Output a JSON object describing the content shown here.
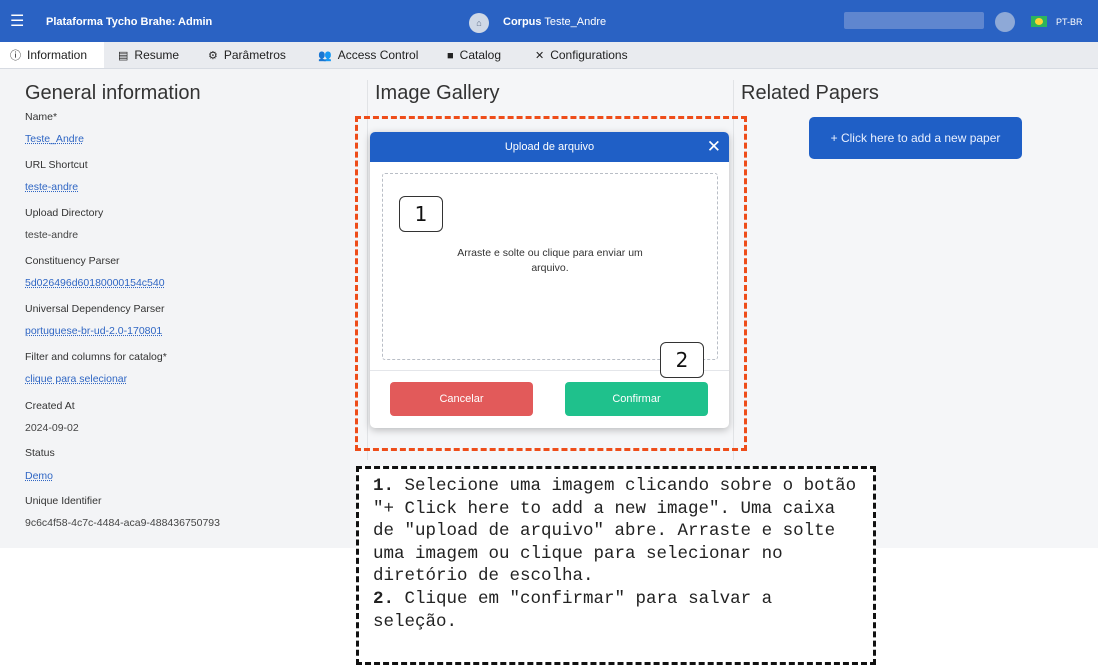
{
  "topbar": {
    "menu_icon": "hamburger-icon",
    "brand": "Plataforma Tycho Brahe: Admin",
    "corpus_label": "Corpus",
    "corpus_name": "Teste_Andre",
    "language": "PT-BR"
  },
  "tabs": [
    {
      "label": "Information",
      "icon": "info-icon"
    },
    {
      "label": "Resume",
      "icon": "document-icon"
    },
    {
      "label": "Parâmetros",
      "icon": "gears-icon"
    },
    {
      "label": "Access Control",
      "icon": "users-icon"
    },
    {
      "label": "Catalog",
      "icon": "book-icon"
    },
    {
      "label": "Configurations",
      "icon": "tools-icon"
    }
  ],
  "general": {
    "title": "General information",
    "fields": [
      {
        "label": "Name*",
        "value": "Teste_Andre"
      },
      {
        "label": "URL Shortcut",
        "value": "teste-andre"
      },
      {
        "label": "Upload Directory",
        "value": "teste-andre"
      },
      {
        "label": "Constituency Parser",
        "value": "5d026496d60180000154c540"
      },
      {
        "label": "Universal Dependency Parser",
        "value": "portuguese-br-ud-2.0-170801"
      },
      {
        "label": "Filter and columns for catalog*",
        "value": "clique para selecionar"
      },
      {
        "label": "Created At",
        "value": "2024-09-02"
      },
      {
        "label": "Status",
        "value": "Demo"
      },
      {
        "label": "Unique Identifier",
        "value": "9c6c4f58-4c7c-4484-aca9-488436750793"
      }
    ]
  },
  "gallery": {
    "title": "Image Gallery"
  },
  "papers": {
    "title": "Related Papers",
    "add_button": "+ Click here to add a new paper"
  },
  "modal": {
    "title": "Upload de arquivo",
    "drop_text": "Arraste e solte ou clique para enviar um arquivo.",
    "cancel": "Cancelar",
    "confirm": "Confirmar"
  },
  "markers": {
    "one": "1",
    "two": "2"
  },
  "instructions": {
    "n1": "1.",
    "t1": " Selecione uma imagem clicando sobre o botão \"+ Click here to add a new image\". Uma caixa de \"upload de arquivo\" abre. Arraste e solte uma imagem ou clique para selecionar no diretório de escolha.",
    "n2": "2.",
    "t2": " Clique em \"confirmar\" para salvar a seleção."
  },
  "colors": {
    "brand_blue": "#2a62c3",
    "annotation_orange": "#ee4d1a",
    "confirm_green": "#1fc18c",
    "cancel_red": "#e25a5a"
  }
}
